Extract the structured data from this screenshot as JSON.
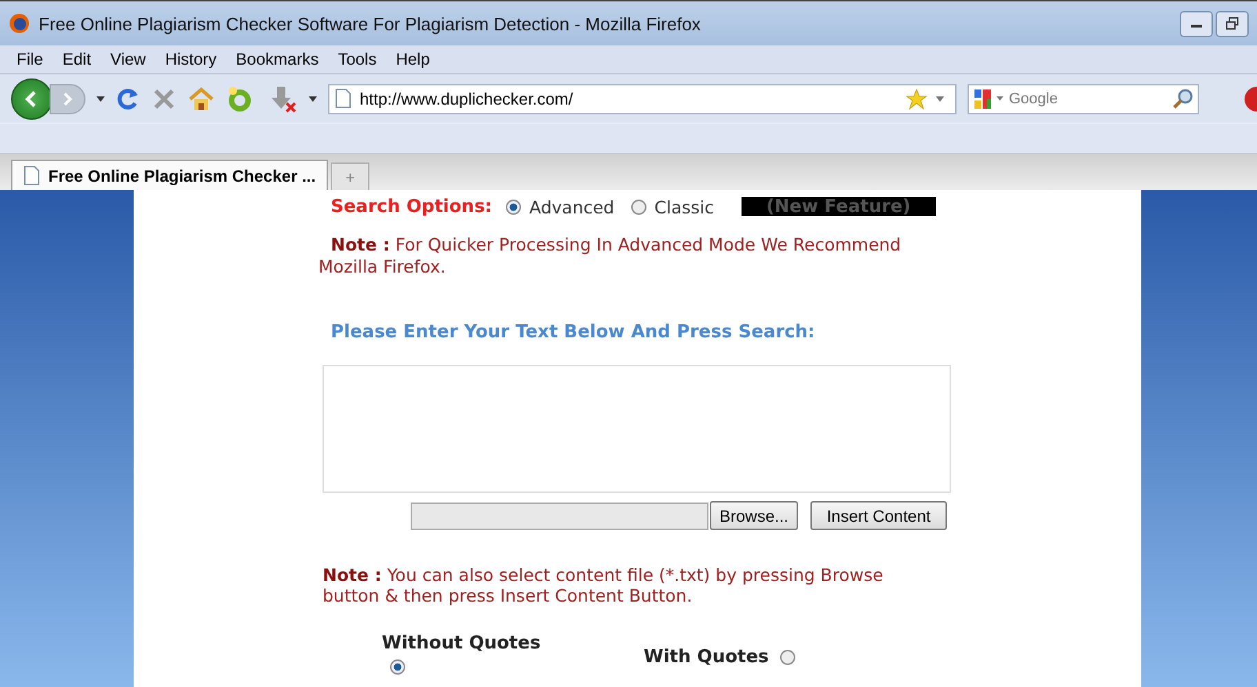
{
  "window": {
    "title": "Free Online Plagiarism Checker Software For Plagiarism Detection - Mozilla Firefox"
  },
  "menu": [
    "File",
    "Edit",
    "View",
    "History",
    "Bookmarks",
    "Tools",
    "Help"
  ],
  "address_bar": {
    "value": "http://www.duplichecker.com/"
  },
  "search_bar": {
    "placeholder": "Google"
  },
  "tabs": [
    {
      "label": "Free Online Plagiarism Checker ...",
      "selected": true
    }
  ],
  "new_tab": "+",
  "search_options": {
    "label": "Search Options:",
    "options": [
      {
        "label": "Advanced",
        "selected": true
      },
      {
        "label": "Classic",
        "selected": false
      }
    ],
    "badge": "(New Feature)"
  },
  "note1": {
    "label": "Note :",
    "text": "For Quicker Processing In Advanced Mode We Recommend Mozilla Firefox."
  },
  "prompt": "Please Enter Your Text Below And Press Search:",
  "file_buttons": [
    "Browse...",
    "Insert Content"
  ],
  "note2": {
    "label": "Note :",
    "text": "You can also select content file (*.txt) by pressing Browse button & then press Insert Content Button."
  },
  "quote_options": [
    {
      "label": "Without Quotes",
      "selected": true
    },
    {
      "label": "With Quotes",
      "selected": false
    }
  ]
}
